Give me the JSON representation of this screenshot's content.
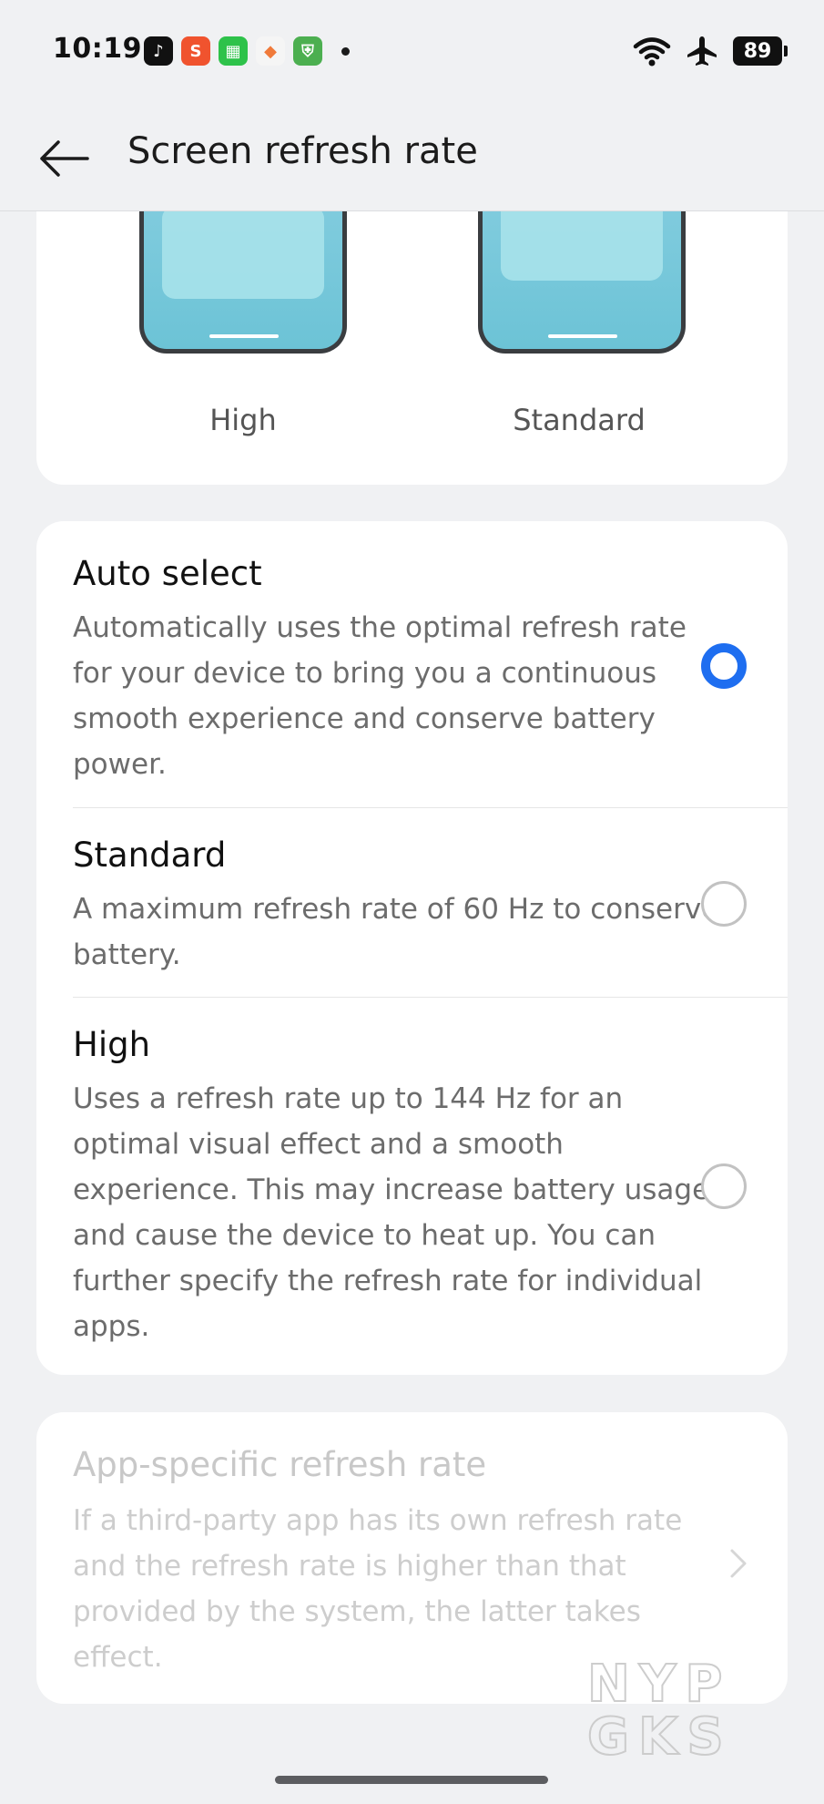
{
  "status_bar": {
    "time": "10:19",
    "app_icons": [
      {
        "name": "tiktok-icon",
        "glyph": "♪",
        "color": "#111111"
      },
      {
        "name": "shopee-icon",
        "glyph": "S",
        "color": "#f0532e"
      },
      {
        "name": "calculator-app-icon",
        "glyph": "▦",
        "color": "#2ec24a"
      },
      {
        "name": "game-icon",
        "glyph": "◆",
        "color": "#f07a3a"
      },
      {
        "name": "security-shield-icon",
        "glyph": "⛨",
        "color": "#4caf50"
      }
    ],
    "battery": "89"
  },
  "header": {
    "title": "Screen refresh rate"
  },
  "preview": {
    "high_label": "High",
    "standard_label": "Standard"
  },
  "options": [
    {
      "title": "Auto select",
      "description": "Automatically uses the optimal refresh rate for your device to bring you a continuous smooth experience and conserve battery power.",
      "selected": true
    },
    {
      "title": "Standard",
      "description": "A maximum refresh rate of 60 Hz to conserve battery.",
      "selected": false
    },
    {
      "title": "High",
      "description": "Uses a refresh rate up to 144 Hz for an optimal visual effect and a smooth experience. This may increase battery usage and cause the device to heat up. You can further specify the refresh rate for individual apps.",
      "selected": false
    }
  ],
  "app_specific": {
    "title": "App-specific refresh rate",
    "description": "If a third-party app has its own refresh rate and the refresh rate is higher than that provided by the system, the latter takes effect."
  },
  "watermark": "NYPGKS",
  "colors": {
    "accent": "#1e6ef0",
    "background": "#f0f1f3",
    "card": "#ffffff"
  }
}
